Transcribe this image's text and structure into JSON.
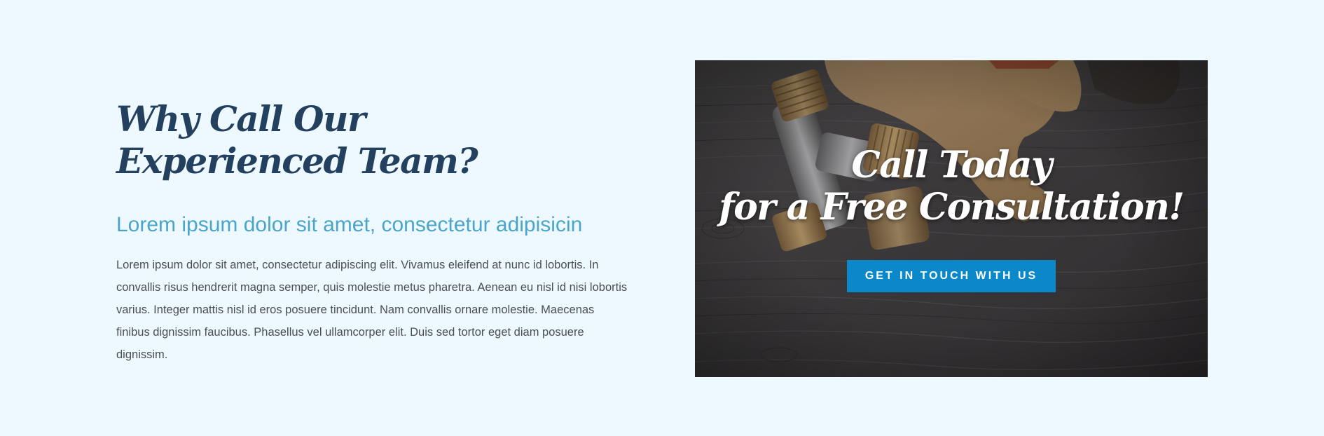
{
  "content": {
    "heading_line1": "Why Call Our",
    "heading_line2": "Experienced Team?",
    "subheading": "Lorem ipsum dolor sit amet, consectetur adipisicin",
    "body": "Lorem ipsum dolor sit amet, consectetur adipiscing elit. Vivamus eleifend at nunc id lobortis. In convallis risus hendrerit magna semper, quis molestie metus pharetra. Aenean eu nisl id nisi lobortis varius. Integer mattis nisl id eros posuere tincidunt. Nam convallis ornare molestie. Maecenas finibus dignissim faucibus. Phasellus vel ullamcorper elit. Duis sed tortor eget diam posuere dignissim."
  },
  "promo": {
    "title_line1": "Call Today",
    "title_line2": "for a Free Consultation!",
    "button_label": "Get in touch with us"
  },
  "colors": {
    "page_background": "#eef8ff",
    "heading": "#23405f",
    "subheading": "#4ba5c9",
    "body_text": "#4a4f55",
    "button": "#0b88c9"
  }
}
